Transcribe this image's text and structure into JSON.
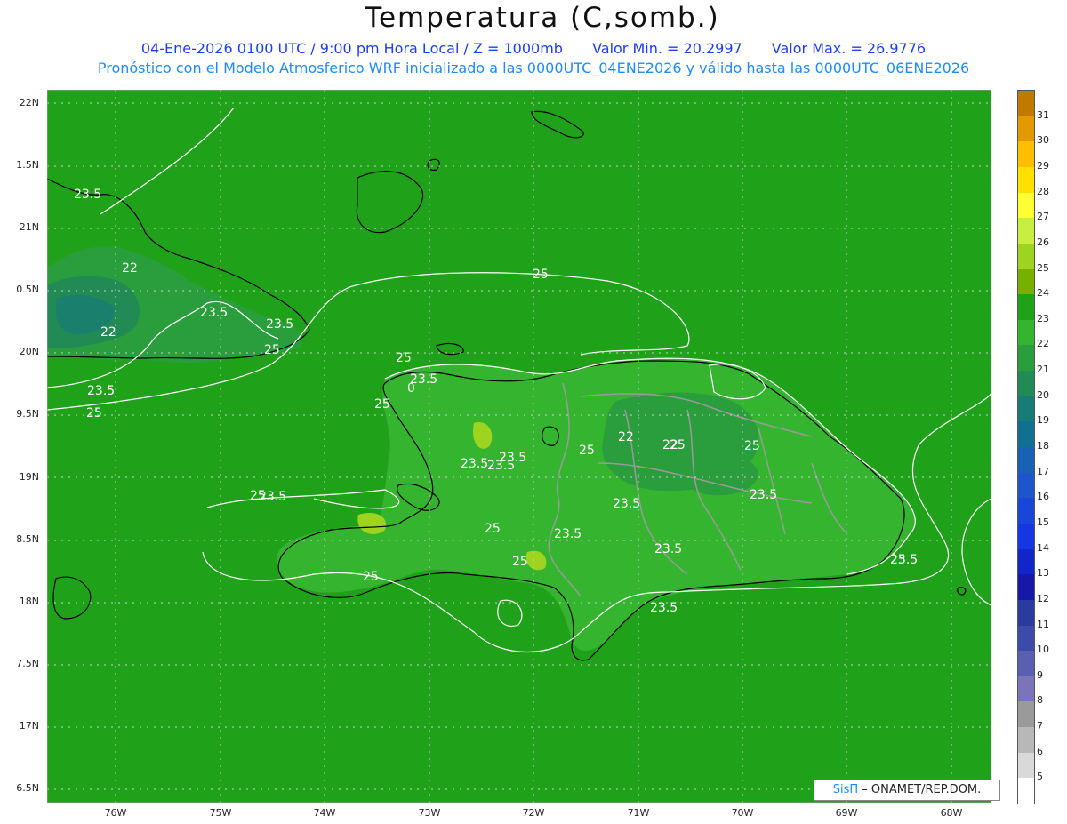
{
  "title": "Temperatura (C,somb.)",
  "subtitle1": {
    "date": "04-Ene-2026  0100 UTC / 9:00 pm Hora Local / Z = 1000mb",
    "min": "Valor Min. = 20.2997",
    "max": "Valor Max. = 26.9776"
  },
  "subtitle2": "Pronóstico con el Modelo Atmosferico WRF inicializado a las 0000UTC_04ENE2026 y válido hasta las  0000UTC_06ENE2026",
  "y_axis_labels": [
    "22N",
    "1.5N",
    "21N",
    "0.5N",
    "20N",
    "9.5N",
    "19N",
    "8.5N",
    "18N",
    "7.5N",
    "17N",
    "6.5N"
  ],
  "x_axis_labels": [
    "76W",
    "75W",
    "74W",
    "73W",
    "72W",
    "71W",
    "70W",
    "69W",
    "68W"
  ],
  "contour_labels": [
    "23.5",
    "22",
    "23.5",
    "23.5",
    "22",
    "25",
    "23.5",
    "25",
    "25",
    "23.5",
    "0",
    "25",
    "25",
    "23.5",
    "23.5",
    "23.5",
    "22",
    "22",
    "25",
    "23.5",
    "25",
    "23.5",
    "25",
    "23.5",
    "25",
    "23.5",
    "23.5",
    "25",
    "23.5",
    "25",
    "25",
    "23.5",
    "25"
  ],
  "colorbar": {
    "labels": [
      "31",
      "30",
      "29",
      "28",
      "27",
      "26",
      "25",
      "24",
      "23",
      "22",
      "21",
      "20",
      "19",
      "18",
      "17",
      "16",
      "15",
      "14",
      "13",
      "12",
      "11",
      "10",
      "9",
      "8",
      "7",
      "6",
      "5"
    ],
    "colors": [
      "#c07a00",
      "#e29a00",
      "#ffbf00",
      "#ffe000",
      "#ffff33",
      "#c8ee40",
      "#9ed320",
      "#78b000",
      "#1fa21a",
      "#35b52f",
      "#2a9d3c",
      "#228a55",
      "#177b78",
      "#117092",
      "#1862b5",
      "#1c55cc",
      "#1846d8",
      "#1536e0",
      "#1225c8",
      "#1818a8",
      "#2a3a9e",
      "#3d4ba8",
      "#5a60b0",
      "#7b74b8",
      "#9a9a9a",
      "#b8b8b8",
      "#d9d9d9",
      "#ffffff"
    ]
  },
  "credit": {
    "logo": "SisΠ",
    "text": " – ONAMET/REP.DOM."
  }
}
